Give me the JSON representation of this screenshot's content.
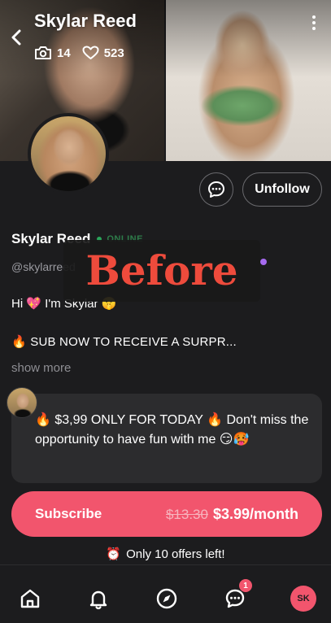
{
  "header": {
    "title": "Skylar Reed",
    "photo_count": "14",
    "like_count": "523"
  },
  "profile": {
    "name": "Skylar Reed",
    "status": "ONLINE",
    "handle": "@skylarreed",
    "bio_line_1": "Hi 💖 I'm Skylar 🤫",
    "bio_line_2": "🔥 SUB NOW TO RECEIVE A SURPR...",
    "show_more": "show more"
  },
  "actions": {
    "unfollow_label": "Unfollow"
  },
  "overlay": {
    "label": "Before"
  },
  "message": {
    "text": "🔥 $3,99 ONLY FOR TODAY 🔥 Don't miss the opportunity to have fun with me 😏🥵"
  },
  "subscribe": {
    "label": "Subscribe",
    "old_price": "$13.30",
    "new_price": "$3.99/month"
  },
  "offers": {
    "icon": "⏰",
    "text": "Only 10 offers left!"
  },
  "nav": {
    "messages_badge": "1",
    "avatar_initials": "SK"
  },
  "colors": {
    "accent": "#f2556d",
    "background": "#1c1c1e",
    "card": "#2c2c2e",
    "online": "#2aa55a",
    "overlay_text": "#ee4b3c"
  },
  "icons": [
    "back-arrow-icon",
    "camera-icon",
    "heart-icon",
    "more-vertical-icon",
    "chat-icon",
    "home-icon",
    "bell-icon",
    "compass-icon",
    "messages-icon",
    "alarm-clock-icon"
  ]
}
